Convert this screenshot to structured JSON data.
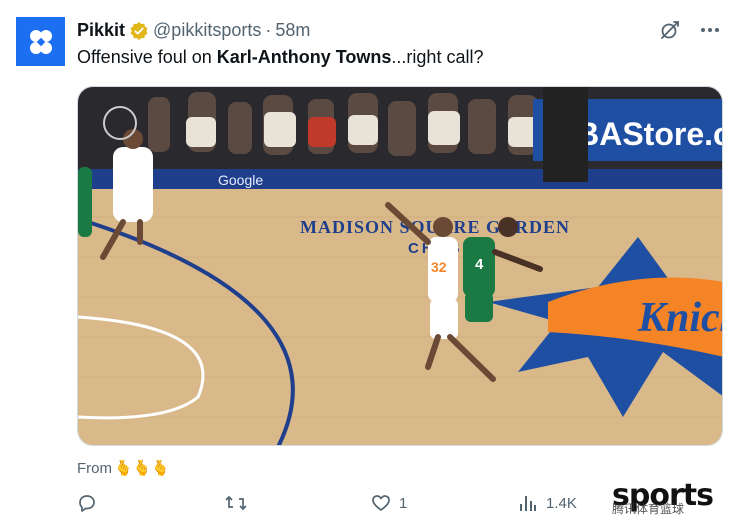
{
  "tweet": {
    "display_name": "Pikkit",
    "handle": "@pikkitsports",
    "separator": "·",
    "time": "58m",
    "text_before": "Offensive foul on ",
    "text_bold": "Karl-Anthony Towns",
    "text_after": "...right call?",
    "from_label": "From",
    "from_emoji": "🫰🫰🫰"
  },
  "media": {
    "arena_text": "MADISON SQUARE GARDEN",
    "sponsor_text": "CHASE",
    "board_text": "Google",
    "store_text": "NBAStore.com",
    "knicks_logo_text": "Knicks",
    "jersey_knicks": "32",
    "jersey_celtics": "4"
  },
  "actions": {
    "reply_count": "",
    "retweet_count": "",
    "like_count": "1",
    "views_count": "1.4K"
  },
  "watermark": {
    "brand": "sports",
    "sub": "腾讯体育篮球"
  },
  "colors": {
    "avatar_bg": "#1d6ff2",
    "verified": "#e2b719",
    "muted_text": "#536471",
    "court_wood": "#d9b98a",
    "knicks_orange": "#f58426",
    "knicks_blue": "#1f4fa3",
    "celtics_green": "#1b7a43"
  }
}
